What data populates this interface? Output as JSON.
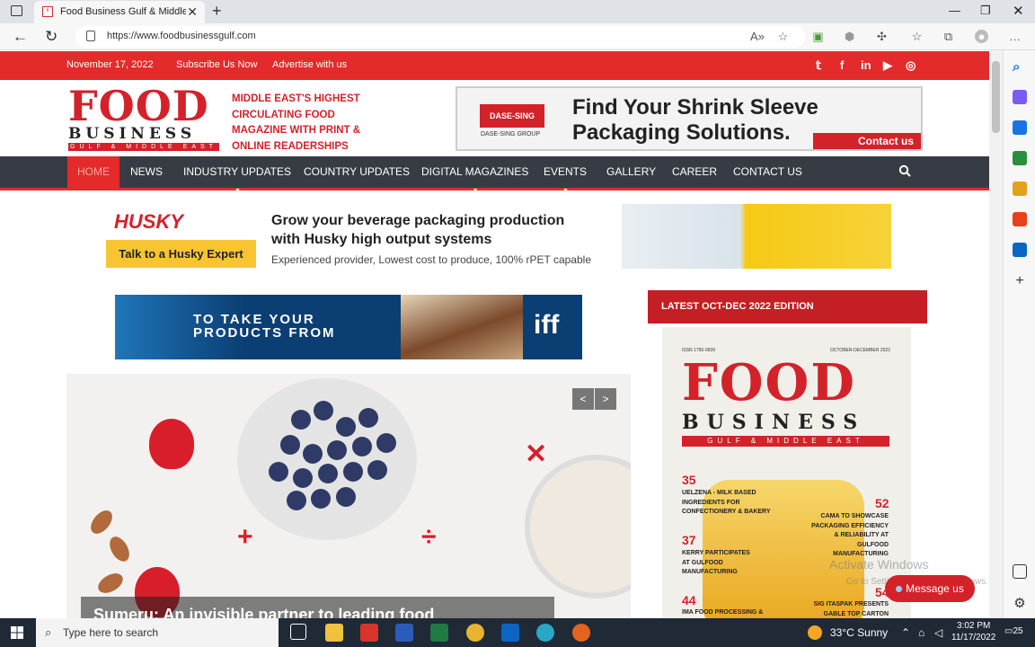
{
  "browser": {
    "tab_title": "Food Business Gulf & Middle East",
    "url": "https://www.foodbusinessgulf.com"
  },
  "site": {
    "date": "November 17, 2022",
    "subscribe": "Subscribe Us Now",
    "advertise": "Advertise with us",
    "logo_food": "FOOD",
    "logo_business": "BUSINESS",
    "logo_gulf": "GULF & MIDDLE EAST",
    "tagline": "MIDDLE EAST'S HIGHEST CIRCULATING FOOD MAGAZINE WITH PRINT & ONLINE READERSHIPS"
  },
  "ad_top": {
    "brand": "DASE-SING",
    "brand_sub": "DASE-SING GROUP",
    "headline_1": "Find Your Shrink Sleeve",
    "headline_2": "Packaging Solutions.",
    "cta": "Contact us"
  },
  "nav": [
    "HOME",
    "NEWS",
    "INDUSTRY UPDATES",
    "COUNTRY UPDATES",
    "DIGITAL MAGAZINES",
    "EVENTS",
    "GALLERY",
    "CAREER",
    "CONTACT US"
  ],
  "husky": {
    "logo": "HUSKY",
    "button": "Talk to a Husky Expert",
    "line1": "Grow your beverage packaging production",
    "line2": "with Husky high output systems",
    "line3": "Experienced provider, Lowest cost to produce, 100% rPET capable"
  },
  "iff": {
    "line1": "TO TAKE YOUR",
    "line2": "PRODUCTS FROM",
    "logo": "iff"
  },
  "hero": {
    "caption": "Sumeru: An invisible partner to leading food"
  },
  "edition": {
    "title": "LATEST OCT-DEC 2022 EDITION",
    "issn": "ISSN 1755-0939",
    "date": "OCTOBER-DECEMBER 2022",
    "food": "FOOD",
    "business": "BUSINESS",
    "gulf": "GULF & MIDDLE EAST",
    "stories": [
      {
        "num": "35",
        "text": "UELZENA - MILK BASED INGREDIENTS FOR CONFECTIONERY & BAKERY"
      },
      {
        "num": "52",
        "text": "CAMA TO SHOWCASE PACKAGING EFFICIENCY & RELIABILITY AT GULFOOD MANUFACTURING"
      },
      {
        "num": "37",
        "text": "KERRY PARTICIPATES AT GULFOOD MANUFACTURING"
      },
      {
        "num": "44",
        "text": "IMA FOOD PROCESSING &"
      },
      {
        "num": "54",
        "text": "SIG ITASPAK PRESENTS GABLE TOP CARTON"
      }
    ]
  },
  "overlay": {
    "activate_1": "Activate Windows",
    "activate_2": "Go to Settings to activate Windows.",
    "message_btn": "Message us"
  },
  "taskbar": {
    "search_placeholder": "Type here to search",
    "weather": "33°C  Sunny",
    "time": "3:02 PM",
    "date": "11/17/2022",
    "badge": "25"
  },
  "colors": {
    "brand_red": "#e32b2b",
    "nav_dark": "#373c44",
    "accent_yellow": "#f9c432"
  }
}
